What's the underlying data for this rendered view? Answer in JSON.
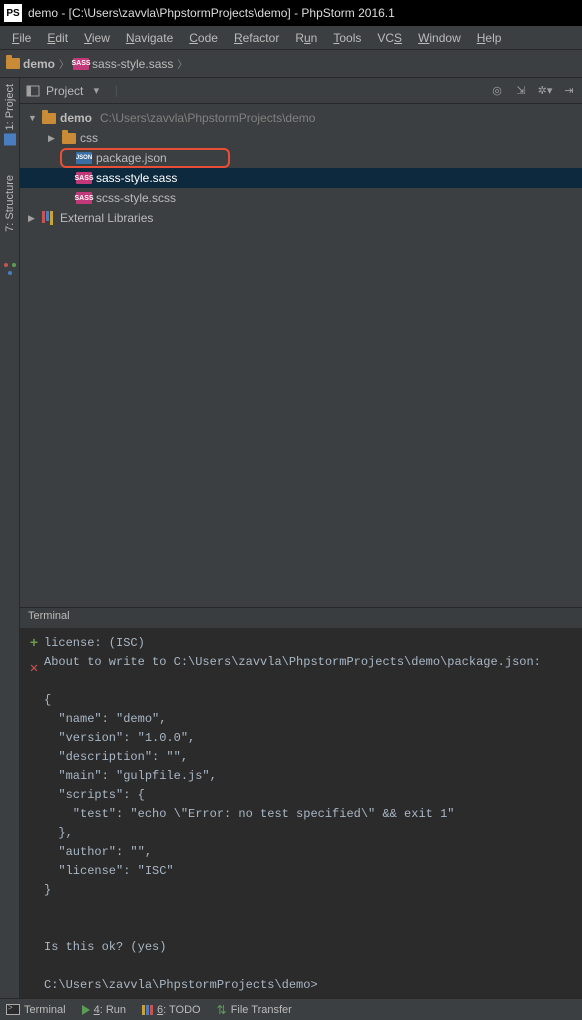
{
  "titlebar": {
    "app_icon": "PS",
    "text": "demo - [C:\\Users\\zavvla\\PhpstormProjects\\demo] - PhpStorm 2016.1"
  },
  "menubar": {
    "items": [
      {
        "u": "F",
        "rest": "ile"
      },
      {
        "u": "E",
        "rest": "dit"
      },
      {
        "u": "V",
        "rest": "iew"
      },
      {
        "u": "N",
        "rest": "avigate"
      },
      {
        "u": "C",
        "rest": "ode"
      },
      {
        "u": "R",
        "rest": "efactor"
      },
      {
        "u": "",
        "rest": "Run",
        "plain": true,
        "ru": "u"
      },
      {
        "u": "T",
        "rest": "ools"
      },
      {
        "u": "",
        "rest": "VCS",
        "plain": true,
        "ru": "S"
      },
      {
        "u": "W",
        "rest": "indow"
      },
      {
        "u": "H",
        "rest": "elp"
      }
    ]
  },
  "breadcrumb": {
    "root": "demo",
    "current": "sass-style.sass"
  },
  "sidebar": {
    "project_label": "1: Project",
    "structure_label": "7: Structure"
  },
  "project_header": {
    "label": "Project"
  },
  "tree": {
    "root": "demo",
    "root_path": "C:\\Users\\zavvla\\PhpstormProjects\\demo",
    "items": [
      {
        "name": "css",
        "type": "folder"
      },
      {
        "name": "package.json",
        "type": "json",
        "highlighted": true
      },
      {
        "name": "sass-style.sass",
        "type": "sass",
        "selected": true
      },
      {
        "name": "scss-style.scss",
        "type": "sass"
      }
    ],
    "external": "External Libraries"
  },
  "terminal": {
    "tab_label": "Terminal",
    "text": "license: (ISC)\nAbout to write to C:\\Users\\zavvla\\PhpstormProjects\\demo\\package.json:\n\n{\n  \"name\": \"demo\",\n  \"version\": \"1.0.0\",\n  \"description\": \"\",\n  \"main\": \"gulpfile.js\",\n  \"scripts\": {\n    \"test\": \"echo \\\"Error: no test specified\\\" && exit 1\"\n  },\n  \"author\": \"\",\n  \"license\": \"ISC\"\n}\n\n\nIs this ok? (yes)\n\nC:\\Users\\zavvla\\PhpstormProjects\\demo>"
  },
  "statusbar": {
    "terminal": "Terminal",
    "run_u": "4",
    "run_rest": ": Run",
    "todo_u": "6",
    "todo_rest": ": TODO",
    "file_transfer": "File Transfer"
  }
}
